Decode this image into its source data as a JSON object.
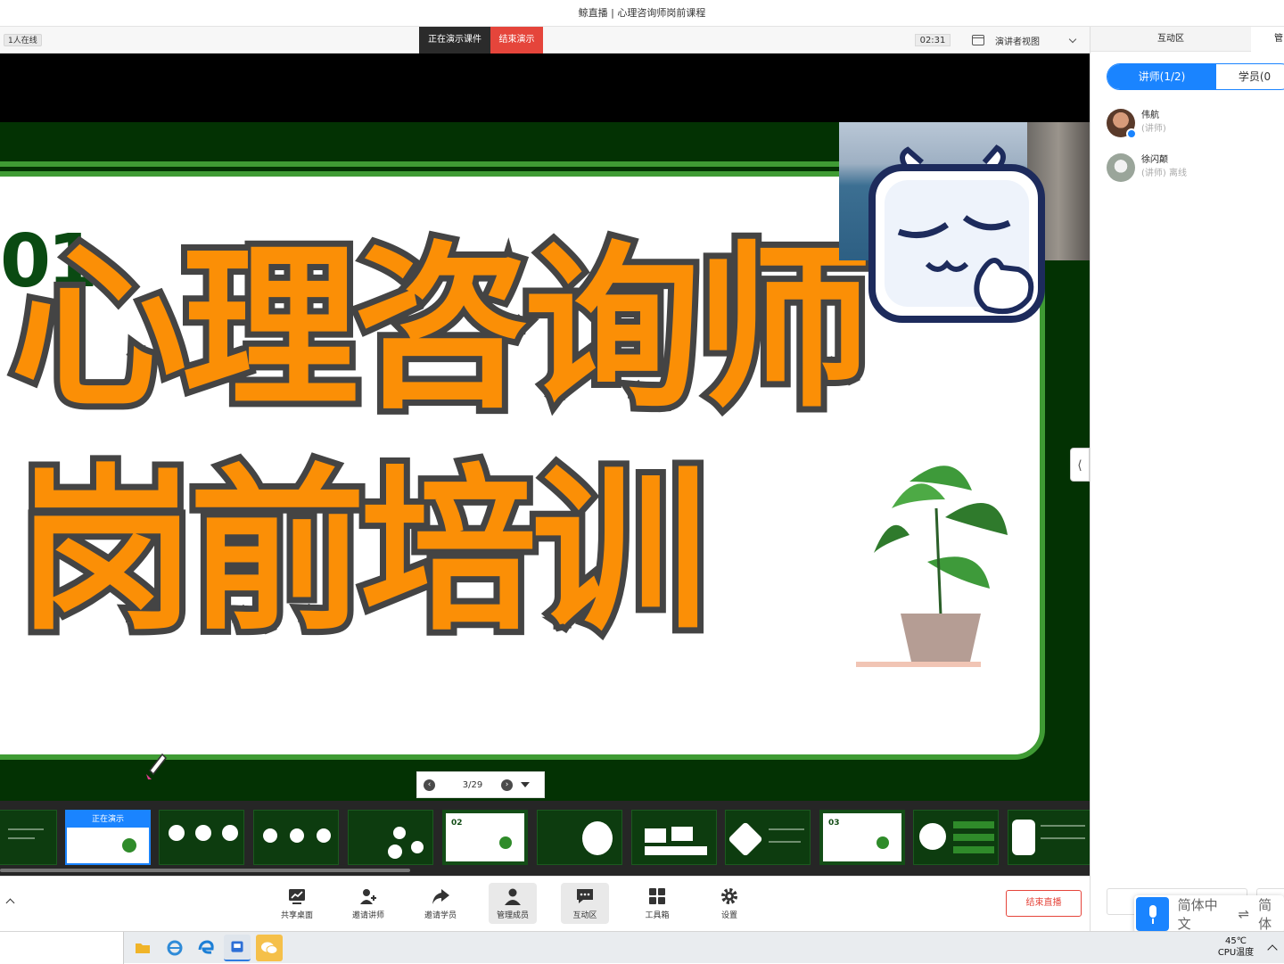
{
  "window": {
    "title": "鲸直播 | 心理咨询师岗前课程"
  },
  "toolbar": {
    "online_count": "1人在线",
    "presenting_label": "正在演示课件",
    "end_presentation_label": "结束演示",
    "timer": "02:31",
    "view_select": "演讲者视图"
  },
  "slide": {
    "chapter_number": "01",
    "title_line1": "心理咨询师",
    "title_line2": "岗前培训"
  },
  "pager": {
    "current": "3/29"
  },
  "thumbnails": {
    "active_caption": "正在演示",
    "items": [
      {
        "chapter": ""
      },
      {
        "chapter": ""
      },
      {
        "chapter": ""
      },
      {
        "chapter": ""
      },
      {
        "chapter": ""
      },
      {
        "chapter": "02"
      },
      {
        "chapter": ""
      },
      {
        "chapter": ""
      },
      {
        "chapter": ""
      },
      {
        "chapter": "03"
      },
      {
        "chapter": ""
      },
      {
        "chapter": ""
      }
    ]
  },
  "bottom_tools": [
    {
      "label": "共享桌面",
      "icon": "share-screen-icon"
    },
    {
      "label": "邀请讲师",
      "icon": "invite-lecturer-icon"
    },
    {
      "label": "邀请学员",
      "icon": "share-arrow-icon"
    },
    {
      "label": "管理成员",
      "icon": "members-icon"
    },
    {
      "label": "互动区",
      "icon": "chat-icon"
    },
    {
      "label": "工具箱",
      "icon": "toolbox-icon"
    },
    {
      "label": "设置",
      "icon": "gear-icon"
    }
  ],
  "end_live_label": "结束直播",
  "right_panel": {
    "tab_interaction": "互动区",
    "tab_other": "管",
    "segment_lecturers": "讲师(1/2)",
    "segment_students": "学员(0",
    "members": [
      {
        "name": "伟航",
        "role": "(讲师)",
        "status": ""
      },
      {
        "name": "徐闪颠",
        "role": "(讲师)",
        "status": "离线"
      }
    ]
  },
  "ime": {
    "lang": "简体中文",
    "switch": "⇌",
    "lang2": "简体"
  },
  "taskbar": {
    "temp": "45℃",
    "temp_label": "CPU温度"
  },
  "colors": {
    "accent": "#1a84ff",
    "danger": "#e5453b",
    "slide_green": "#033203",
    "title_orange": "#fb8f06"
  }
}
